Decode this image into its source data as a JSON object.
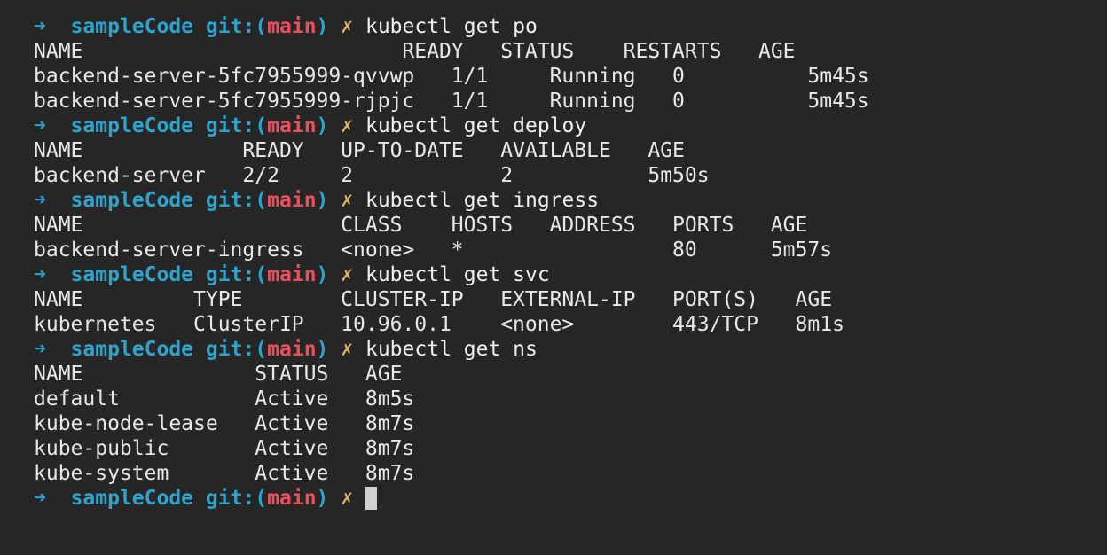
{
  "prompt": {
    "arrow": "➜",
    "dir": "sampleCode",
    "git_prefix": "git:(",
    "branch": "main",
    "git_suffix": ")",
    "dirty": "✗"
  },
  "blocks": [
    {
      "command": "kubectl get po",
      "lines": [
        "NAME                          READY   STATUS    RESTARTS   AGE",
        "backend-server-5fc7955999-qvvwp   1/1     Running   0          5m45s",
        "backend-server-5fc7955999-rjpjc   1/1     Running   0          5m45s"
      ]
    },
    {
      "command": "kubectl get deploy",
      "lines": [
        "NAME             READY   UP-TO-DATE   AVAILABLE   AGE",
        "backend-server   2/2     2            2           5m50s"
      ]
    },
    {
      "command": "kubectl get ingress",
      "lines": [
        "NAME                     CLASS    HOSTS   ADDRESS   PORTS   AGE",
        "backend-server-ingress   <none>   *                 80      5m57s"
      ]
    },
    {
      "command": "kubectl get svc",
      "lines": [
        "NAME         TYPE        CLUSTER-IP   EXTERNAL-IP   PORT(S)   AGE",
        "kubernetes   ClusterIP   10.96.0.1    <none>        443/TCP   8m1s"
      ]
    },
    {
      "command": "kubectl get ns",
      "lines": [
        "NAME              STATUS   AGE",
        "default           Active   8m5s",
        "kube-node-lease   Active   8m7s",
        "kube-public       Active   8m7s",
        "kube-system       Active   8m7s"
      ]
    }
  ],
  "colors": {
    "background": "#262626",
    "prompt_cyan": "#2fa3c9",
    "branch_red": "#e8505b",
    "text": "#e8e8e8"
  }
}
